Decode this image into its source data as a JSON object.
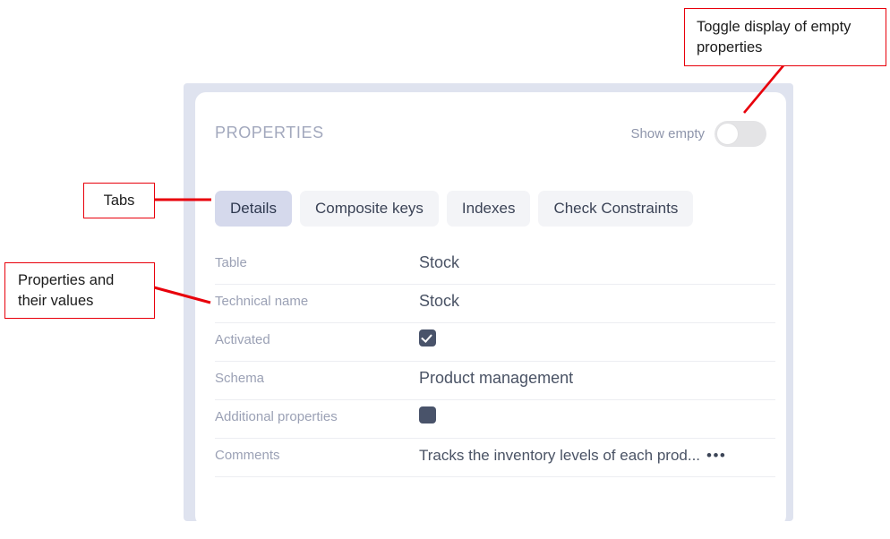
{
  "panel": {
    "title": "PROPERTIES",
    "show_empty": {
      "label": "Show empty",
      "state": "off"
    },
    "tabs": [
      {
        "label": "Details",
        "active": true
      },
      {
        "label": "Composite keys",
        "active": false
      },
      {
        "label": "Indexes",
        "active": false
      },
      {
        "label": "Check Constraints",
        "active": false
      }
    ],
    "properties": [
      {
        "label": "Table",
        "value": "Stock",
        "type": "text"
      },
      {
        "label": "Technical name",
        "value": "Stock",
        "type": "text"
      },
      {
        "label": "Activated",
        "value": "",
        "type": "checkbox-checked"
      },
      {
        "label": "Schema",
        "value": "Product management",
        "type": "text"
      },
      {
        "label": "Additional properties",
        "value": "",
        "type": "square-filled"
      },
      {
        "label": "Comments",
        "value": "Tracks the inventory levels of each prod...",
        "type": "text-truncated",
        "more": "•••"
      }
    ]
  },
  "annotations": [
    {
      "id": "toggle",
      "text": "Toggle display of empty properties"
    },
    {
      "id": "tabs",
      "text": "Tabs"
    },
    {
      "id": "properties",
      "text": "Properties and their values"
    }
  ],
  "colors": {
    "frame": "#dfe3ef",
    "tab_active_bg": "#d5d9ec",
    "tab_bg": "#f3f4f7",
    "label": "#9ba1b5",
    "value": "#4a5365",
    "annotation": "#e8000b",
    "control_dark": "#49536a"
  }
}
